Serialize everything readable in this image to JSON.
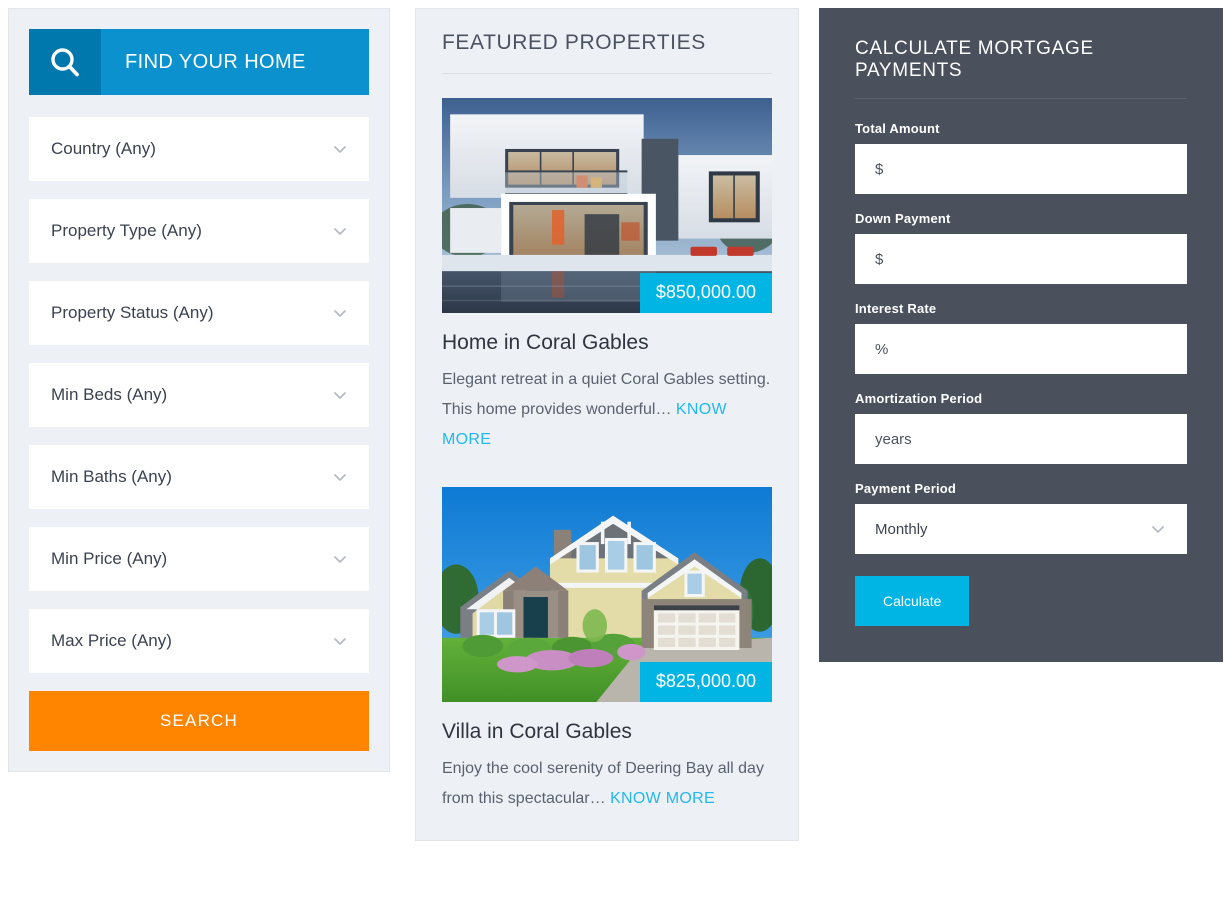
{
  "search_panel": {
    "header": {
      "icon": "search-icon",
      "title": "FIND YOUR HOME"
    },
    "fields": [
      {
        "label": "Country (Any)",
        "name": "country"
      },
      {
        "label": "Property Type (Any)",
        "name": "property-type"
      },
      {
        "label": "Property Status (Any)",
        "name": "property-status"
      },
      {
        "label": "Min Beds (Any)",
        "name": "min-beds"
      },
      {
        "label": "Min Baths (Any)",
        "name": "min-baths"
      },
      {
        "label": "Min Price (Any)",
        "name": "min-price"
      },
      {
        "label": "Max Price (Any)",
        "name": "max-price"
      }
    ],
    "submit_label": "SEARCH",
    "colors": {
      "icon_block": "#0078ad",
      "label_block": "#0b91ce",
      "submit": "#ff8400",
      "panel_bg": "#edf0f5"
    }
  },
  "featured": {
    "title": "FEATURED PROPERTIES",
    "know_more_label": "KNOW MORE",
    "properties": [
      {
        "price": "$850,000.00",
        "title": "Home in Coral Gables",
        "description": "Elegant retreat in a quiet Coral Gables setting. This home provides wonderful…",
        "image": "modern-white-villa-at-dusk-with-pool"
      },
      {
        "price": "$825,000.00",
        "title": "Villa in Coral Gables",
        "description": "Enjoy the cool serenity of Deering Bay all day from this spectacular…",
        "image": "craftsman-house-with-lawn-and-blue-sky"
      }
    ],
    "colors": {
      "price_badge": "#00b4e3",
      "link": "#22b8ea",
      "panel_bg": "#edf0f5"
    }
  },
  "calculator": {
    "title": "CALCULATE MORTGAGE PAYMENTS",
    "fields": [
      {
        "label": "Total Amount",
        "placeholder": "$",
        "name": "total-amount"
      },
      {
        "label": "Down Payment",
        "placeholder": "$",
        "name": "down-payment"
      },
      {
        "label": "Interest Rate",
        "placeholder": "%",
        "name": "interest-rate"
      },
      {
        "label": "Amortization Period",
        "placeholder": "years",
        "name": "amortization-period"
      }
    ],
    "payment_period": {
      "label": "Payment Period",
      "value": "Monthly"
    },
    "submit_label": "Calculate",
    "colors": {
      "panel_bg": "#4a505c",
      "submit": "#00b4e3"
    }
  }
}
